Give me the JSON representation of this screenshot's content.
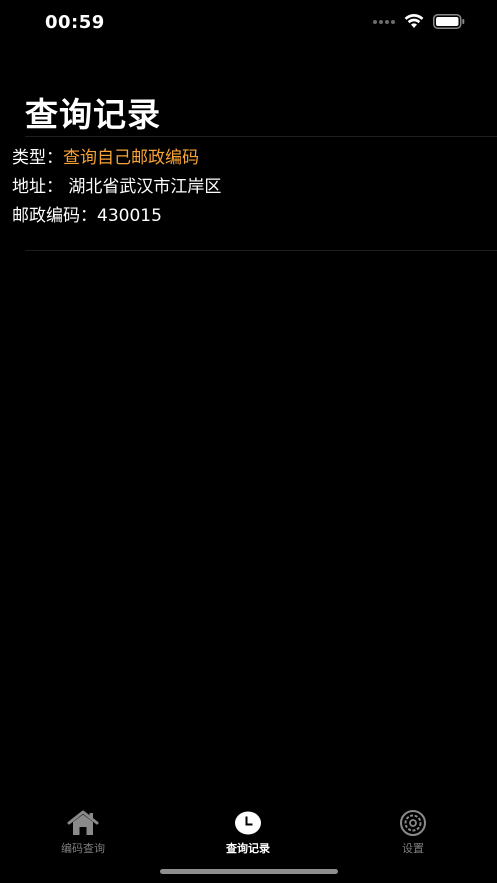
{
  "status_bar": {
    "time": "00:59"
  },
  "page": {
    "title": "查询记录"
  },
  "record": {
    "type_label": "类型：",
    "type_value": "查询自己邮政编码",
    "address_label": "地址：",
    "address_value": "湖北省武汉市江岸区",
    "postcode_label": "邮政编码：",
    "postcode_value": "430015"
  },
  "tab_bar": {
    "tabs": [
      {
        "label": "编码查询",
        "icon": "house-icon",
        "active": false
      },
      {
        "label": "查询记录",
        "icon": "clock-icon",
        "active": true
      },
      {
        "label": "设置",
        "icon": "gear-icon",
        "active": false
      }
    ]
  },
  "colors": {
    "background": "#000000",
    "accent": "#f7a335",
    "tab_inactive": "#7d7d7d",
    "tab_active": "#ffffff"
  }
}
